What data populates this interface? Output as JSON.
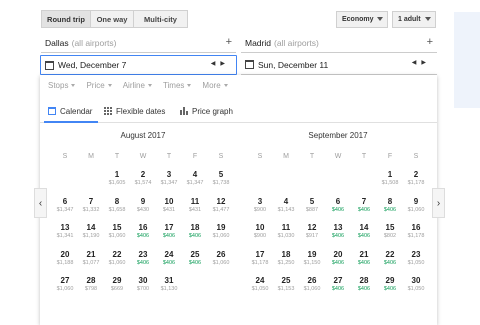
{
  "trip_types": [
    {
      "label": "Round trip",
      "active": true
    },
    {
      "label": "One way",
      "active": false
    },
    {
      "label": "Multi-city",
      "active": false
    }
  ],
  "cabin": {
    "value": "Economy"
  },
  "passengers": {
    "value": "1 adult"
  },
  "origin": {
    "city": "Dallas",
    "detail": "(all airports)",
    "add": "+"
  },
  "destination": {
    "city": "Madrid",
    "detail": "(all airports)",
    "add": "+"
  },
  "depart_date": {
    "value": "Wed, December 7"
  },
  "return_date": {
    "value": "Sun, December 11"
  },
  "filters": [
    "Stops",
    "Price",
    "Airline",
    "Times",
    "More"
  ],
  "tabs": {
    "calendar": "Calendar",
    "flexible": "Flexible dates",
    "graph": "Price graph"
  },
  "weekdays": [
    "S",
    "M",
    "T",
    "W",
    "T",
    "F",
    "S"
  ],
  "months": [
    {
      "title": "August 2017",
      "weeks": [
        [
          null,
          null,
          {
            "d": "1",
            "p": "$1,605"
          },
          {
            "d": "2",
            "p": "$1,574"
          },
          {
            "d": "3",
            "p": "$1,347"
          },
          {
            "d": "4",
            "p": "$1,347"
          },
          {
            "d": "5",
            "p": "$1,738"
          }
        ],
        [
          {
            "d": "6",
            "p": "$1,347"
          },
          {
            "d": "7",
            "p": "$1,332"
          },
          {
            "d": "8",
            "p": "$1,658"
          },
          {
            "d": "9",
            "p": "$430"
          },
          {
            "d": "10",
            "p": "$431"
          },
          {
            "d": "11",
            "p": "$431"
          },
          {
            "d": "12",
            "p": "$1,477"
          }
        ],
        [
          {
            "d": "13",
            "p": "$1,341"
          },
          {
            "d": "14",
            "p": "$1,190"
          },
          {
            "d": "15",
            "p": "$1,060"
          },
          {
            "d": "16",
            "p": "$406",
            "low": true
          },
          {
            "d": "17",
            "p": "$406",
            "low": true
          },
          {
            "d": "18",
            "p": "$406",
            "low": true
          },
          {
            "d": "19",
            "p": "$1,060"
          }
        ],
        [
          {
            "d": "20",
            "p": "$1,188"
          },
          {
            "d": "21",
            "p": "$1,077"
          },
          {
            "d": "22",
            "p": "$1,060"
          },
          {
            "d": "23",
            "p": "$406",
            "low": true
          },
          {
            "d": "24",
            "p": "$406",
            "low": true
          },
          {
            "d": "25",
            "p": "$406",
            "low": true
          },
          {
            "d": "26",
            "p": "$1,060"
          }
        ],
        [
          {
            "d": "27",
            "p": "$1,060"
          },
          {
            "d": "28",
            "p": "$798"
          },
          {
            "d": "29",
            "p": "$669"
          },
          {
            "d": "30",
            "p": "$700"
          },
          {
            "d": "31",
            "p": "$1,130"
          },
          null,
          null
        ]
      ]
    },
    {
      "title": "September 2017",
      "weeks": [
        [
          null,
          null,
          null,
          null,
          null,
          {
            "d": "1",
            "p": "$1,508"
          },
          {
            "d": "2",
            "p": "$1,178"
          }
        ],
        [
          {
            "d": "3",
            "p": "$900"
          },
          {
            "d": "4",
            "p": "$1,143"
          },
          {
            "d": "5",
            "p": "$887"
          },
          {
            "d": "6",
            "p": "$406",
            "low": true
          },
          {
            "d": "7",
            "p": "$406",
            "low": true
          },
          {
            "d": "8",
            "p": "$406",
            "low": true
          },
          {
            "d": "9",
            "p": "$1,060"
          }
        ],
        [
          {
            "d": "10",
            "p": "$900"
          },
          {
            "d": "11",
            "p": "$1,030"
          },
          {
            "d": "12",
            "p": "$917"
          },
          {
            "d": "13",
            "p": "$406",
            "low": true
          },
          {
            "d": "14",
            "p": "$406",
            "low": true
          },
          {
            "d": "15",
            "p": "$802"
          },
          {
            "d": "16",
            "p": "$1,178"
          }
        ],
        [
          {
            "d": "17",
            "p": "$1,178"
          },
          {
            "d": "18",
            "p": "$1,250"
          },
          {
            "d": "19",
            "p": "$1,150"
          },
          {
            "d": "20",
            "p": "$406",
            "low": true
          },
          {
            "d": "21",
            "p": "$406",
            "low": true
          },
          {
            "d": "22",
            "p": "$406",
            "low": true
          },
          {
            "d": "23",
            "p": "$1,050"
          }
        ],
        [
          {
            "d": "24",
            "p": "$1,050"
          },
          {
            "d": "25",
            "p": "$1,153"
          },
          {
            "d": "26",
            "p": "$1,060"
          },
          {
            "d": "27",
            "p": "$406",
            "low": true
          },
          {
            "d": "28",
            "p": "$406",
            "low": true
          },
          {
            "d": "29",
            "p": "$406",
            "low": true
          },
          {
            "d": "30",
            "p": "$1,050"
          }
        ]
      ]
    }
  ],
  "nav": {
    "prev": "‹",
    "next": "›"
  },
  "colors": {
    "accent": "#4285f4",
    "low_price": "#0f9d58"
  }
}
